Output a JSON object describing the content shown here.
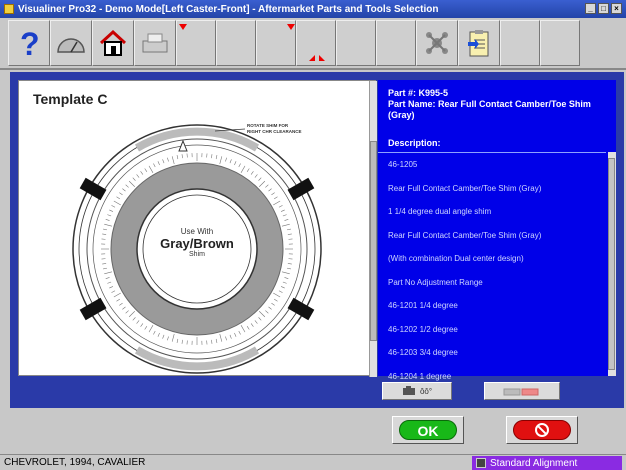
{
  "window": {
    "title": "Visualiner Pro32 - Demo Mode[Left Caster-Front] - Aftermarket Parts and Tools Selection"
  },
  "toolbar": {
    "help_icon": "question-icon",
    "gauge_icon": "gauge-icon",
    "home_icon": "home-icon",
    "print_icon": "printer-icon",
    "settings_icon": "molecule-icon",
    "document_icon": "clipboard-arrow-icon"
  },
  "template": {
    "title": "Template C",
    "note": "ROTATE SHIM FOR\nRIGHT CHR CLEARANCE",
    "center_top": "Use With",
    "center_main": "Gray/Brown",
    "center_bottom": "Shim"
  },
  "part": {
    "number_line": "Part #: K995-5",
    "name_line": "Part Name: Rear Full Contact Camber/Toe Shim (Gray)",
    "description_label": "Description:",
    "description_items": [
      "46-1205",
      "Rear Full Contact Camber/Toe Shim (Gray)",
      "1 1/4 degree dual angle shim",
      "Rear Full Contact Camber/Toe Shim (Gray)",
      "(With combination Dual center design)",
      "Part No Adjustment Range",
      "46-1201 1/4 degree",
      "46-1202 1/2 degree",
      "46-1203 3/4 degree",
      "46-1204 1 degree"
    ]
  },
  "small_buttons": {
    "view_label": "ôô°",
    "print_label": ""
  },
  "actions": {
    "ok_label": "OK"
  },
  "status": {
    "vehicle": "CHEVROLET, 1994, CAVALIER",
    "mode": "Standard Alignment"
  }
}
